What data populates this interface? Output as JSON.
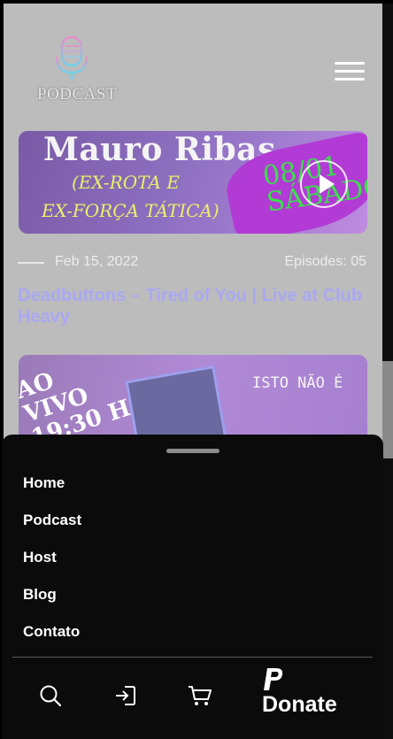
{
  "header": {
    "logo_text": "PODCAST",
    "menu_icon": "hamburger-menu-icon"
  },
  "posts": [
    {
      "thumbnail_text": [
        "Mauro Ribas",
        "(EX-ROTA E",
        "EX-FORÇA TÁTICA)",
        "08/01 SÁBADO"
      ],
      "date": "Feb 15, 2022",
      "episodes": "Episodes: 05",
      "title": "Deadbuttons – Tired of You | Live at Club Heavy"
    },
    {
      "thumbnail_text": [
        "AO VIVO 19:30 H",
        "ISTO NÃO É"
      ]
    }
  ],
  "bottom_sheet": {
    "nav_items": [
      "Home",
      "Podcast",
      "Host",
      "Blog",
      "Contato"
    ],
    "toolbar_icons": [
      "search-icon",
      "login-icon",
      "cart-icon",
      "paypal-icon"
    ],
    "donate_label": "Donate"
  },
  "colors": {
    "overlay_bg": "#bcbcbc",
    "sheet_bg": "#0b0b0b",
    "title_link": "#aaa8f2",
    "text_light": "#ffffff"
  }
}
